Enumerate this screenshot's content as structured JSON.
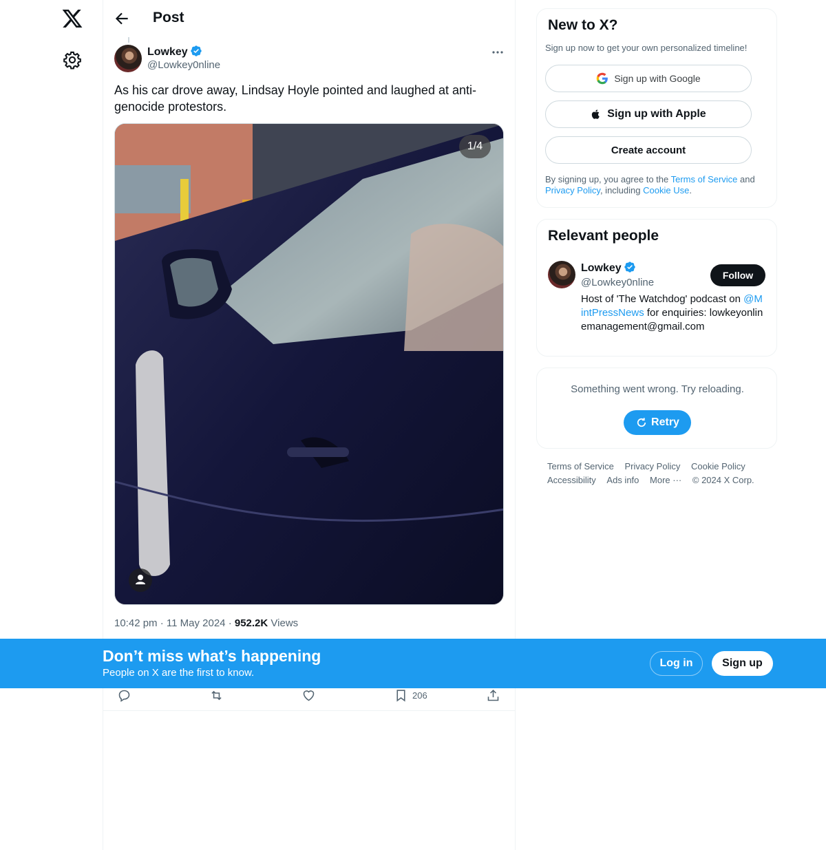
{
  "header": {
    "title": "Post"
  },
  "post": {
    "author_name": "Lowkey",
    "author_handle": "@Lowkey0nline",
    "text": "As his car drove away, Lindsay Hoyle pointed and laughed at anti-genocide protestors.",
    "media_counter": "1/4",
    "time": "10:42 pm",
    "date": "11 May 2024",
    "views_count": "952.2K",
    "views_label": "Views",
    "bookmark_count": "206"
  },
  "signup": {
    "title": "New to X?",
    "subtitle": "Sign up now to get your own personalized timeline!",
    "google_label": "Sign up with Google",
    "apple_label": "Sign up with Apple",
    "create_label": "Create account",
    "legal_prefix": "By signing up, you agree to the ",
    "terms_link": "Terms of Service",
    "legal_and": " and ",
    "privacy_link": "Privacy Policy",
    "legal_including": ", including ",
    "cookie_link": "Cookie Use",
    "legal_end": "."
  },
  "people": {
    "title": "Relevant people",
    "name": "Lowkey",
    "handle": "@Lowkey0nline",
    "follow_label": "Follow",
    "bio_prefix": "Host of 'The Watchdog' podcast on ",
    "bio_mention": "@MintPressNews",
    "bio_suffix": " for enquiries: lowkeyonlinemanagement@gmail.com"
  },
  "error": {
    "message": "Something went wrong. Try reloading.",
    "retry_label": "Retry"
  },
  "footer": {
    "links": [
      "Terms of Service",
      "Privacy Policy",
      "Cookie Policy",
      "Accessibility",
      "Ads info",
      "More ···",
      "© 2024 X Corp."
    ]
  },
  "banner": {
    "title": "Don’t miss what’s happening",
    "subtitle": "People on X are the first to know.",
    "login_label": "Log in",
    "signup_label": "Sign up"
  },
  "colors": {
    "accent": "#1d9bf0",
    "text": "#0f1419",
    "muted": "#536471"
  },
  "icons": [
    "x-logo-icon",
    "gear-icon",
    "back-arrow-icon",
    "verified-badge-icon",
    "more-icon",
    "reply-icon",
    "repost-icon",
    "like-icon",
    "bookmark-icon",
    "share-icon",
    "google-icon",
    "apple-icon",
    "refresh-icon",
    "person-icon"
  ]
}
